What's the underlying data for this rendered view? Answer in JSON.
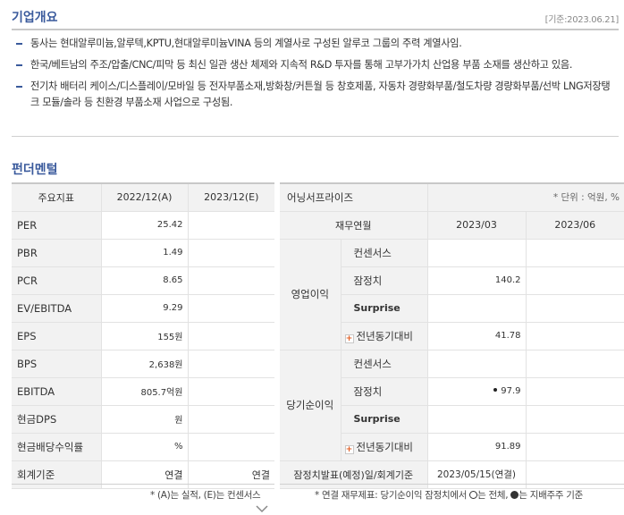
{
  "overview": {
    "title": "기업개요",
    "base_date": "[기준:2023.06.21]",
    "items": [
      "동사는 현대알루미늄,알루텍,KPTU,현대알루미늄VINA 등의 계열사로 구성된 알루코 그룹의 주력 계열사임.",
      "한국/베트남의 주조/압출/CNC/피막 등 최신 일관 생산 체제와 지속적 R&D 투자를 통해 고부가가치 산업용 부품 소재를 생산하고 있음.",
      "전기차 배터리 케이스/디스플레이/모바일 등 전자부품소재,방화창/커튼월 등 창호제품, 자동차 경량화부품/철도차량 경량화부품/선박 LNG저장탱크 모듈/솔라 등 친환경 부품소재 사업으로 구성됨."
    ]
  },
  "fundamental": {
    "title": "펀더멘털",
    "headers": [
      "주요지표",
      "2022/12(A)",
      "2023/12(E)"
    ],
    "rows": [
      {
        "label": "PER",
        "a": "25.42",
        "e": ""
      },
      {
        "label": "PBR",
        "a": "1.49",
        "e": ""
      },
      {
        "label": "PCR",
        "a": "8.65",
        "e": ""
      },
      {
        "label": "EV/EBITDA",
        "a": "9.29",
        "e": ""
      },
      {
        "label": "EPS",
        "a": "155원",
        "e": ""
      },
      {
        "label": "BPS",
        "a": "2,638원",
        "e": ""
      },
      {
        "label": "EBITDA",
        "a": "805.7억원",
        "e": ""
      },
      {
        "label": "현금DPS",
        "a": "원",
        "e": ""
      },
      {
        "label": "현금배당수익률",
        "a": "%",
        "e": ""
      },
      {
        "label": "회계기준",
        "a": "연결",
        "e": "연결"
      }
    ],
    "footnote": "* (A)는 실적, (E)는 컨센서스"
  },
  "earnings": {
    "title": "어닝서프라이즈",
    "unit": "* 단위 : 억원, %",
    "headers": [
      "재무연월",
      "2023/03",
      "2023/06"
    ],
    "groups": [
      {
        "label": "영업이익",
        "rows": [
          {
            "label": "컨센서스",
            "v1": "",
            "v2": ""
          },
          {
            "label": "잠정치",
            "v1": "140.2",
            "v2": ""
          },
          {
            "label": "Surprise",
            "v1": "",
            "v2": ""
          },
          {
            "label": "전년동기대비",
            "v1": "41.78",
            "v2": ""
          }
        ]
      },
      {
        "label": "당기순이익",
        "rows": [
          {
            "label": "컨센서스",
            "v1": "",
            "v2": ""
          },
          {
            "label": "잠정치",
            "v1": "97.9",
            "v2": ""
          },
          {
            "label": "Surprise",
            "v1": "",
            "v2": ""
          },
          {
            "label": "전년동기대비",
            "v1": "91.89",
            "v2": ""
          }
        ]
      }
    ],
    "last_row": {
      "label": "잠정치발표(예정)일/회계기준",
      "v1": "2023/05/15(연결)",
      "v2": ""
    },
    "footnote_a": "* 연결 재무제표: 당기순이익 잠정치에서",
    "footnote_b": "는 전체,",
    "footnote_c": "는 지배주주 기준"
  },
  "icons": {
    "plus": "+",
    "expand": "chevron-down-icon"
  },
  "colors": {
    "title": "#3a5a9c",
    "plus": "#e15a1e"
  }
}
